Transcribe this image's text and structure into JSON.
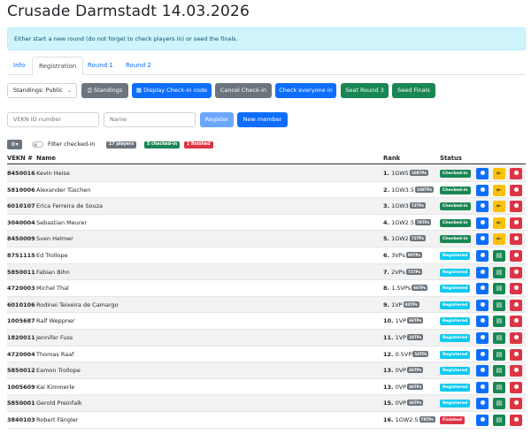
{
  "page": {
    "title": "Crusade Darmstadt 14.03.2026",
    "alert": "Either start a new round (do not forget to check players in) or seed the finals."
  },
  "tabs": [
    {
      "label": "Info",
      "active": false
    },
    {
      "label": "Registration",
      "active": true
    },
    {
      "label": "Round 1",
      "active": false
    },
    {
      "label": "Round 2",
      "active": false
    }
  ],
  "toolbar": {
    "standings_select": "Standings: Public",
    "standings_button": "Standings",
    "display_checkin": "Display Check-in code",
    "cancel_checkin": "Cancel Check-in",
    "check_everyone": "Check everyone in",
    "seat_round": "Seat Round 3",
    "seed_finals": "Seed Finals"
  },
  "registration_form": {
    "vekn_placeholder": "VEKN ID number",
    "name_placeholder": "Name",
    "register_button": "Register",
    "new_member_button": "New member"
  },
  "filter": {
    "label": "Filter checked-in",
    "players": "17 players",
    "checked_in": "5 checked-in",
    "finished": "1 finished"
  },
  "table": {
    "headers": {
      "vekn": "VEKN #",
      "name": "Name",
      "rank": "Rank",
      "status": "Status"
    },
    "rows": [
      {
        "vekn": "8450016",
        "name": "Kevin Heise",
        "rank": "1.",
        "score": "1GW5",
        "tps": "108TPs",
        "status": "Checked-in"
      },
      {
        "vekn": "5810006",
        "name": "Alexander Tüschen",
        "rank": "2.",
        "score": "1GW3.5",
        "tps": "108TPs",
        "status": "Checked-in"
      },
      {
        "vekn": "6010107",
        "name": "Erica Ferreira de Souza",
        "rank": "3.",
        "score": "1GW3",
        "tps": "72TPs",
        "status": "Checked-in"
      },
      {
        "vekn": "3040004",
        "name": "Sebastian Meurer",
        "rank": "4.",
        "score": "1GW2.5",
        "tps": "78TPs",
        "status": "Checked-in"
      },
      {
        "vekn": "8450009",
        "name": "Sven Helmer",
        "rank": "5.",
        "score": "1GW2",
        "tps": "72TPs",
        "status": "Checked-in"
      },
      {
        "vekn": "8751115",
        "name": "Ed Trollope",
        "rank": "6.",
        "score": "3VPs",
        "tps": "90TPs",
        "status": "Registered"
      },
      {
        "vekn": "5850011",
        "name": "Fabian Bihn",
        "rank": "7.",
        "score": "2VPs",
        "tps": "72TPs",
        "status": "Registered"
      },
      {
        "vekn": "4720003",
        "name": "Michel Thal",
        "rank": "8.",
        "score": "1.5VPs",
        "tps": "66TPs",
        "status": "Registered"
      },
      {
        "vekn": "6010106",
        "name": "Rodinei Teixeira de Camargo",
        "rank": "9.",
        "score": "1VP",
        "tps": "84TPs",
        "status": "Registered"
      },
      {
        "vekn": "1005687",
        "name": "Ralf Weppner",
        "rank": "10.",
        "score": "1VP",
        "tps": "66TPs",
        "status": "Registered"
      },
      {
        "vekn": "1820011",
        "name": "Jennifer Fuss",
        "rank": "11.",
        "score": "1VP",
        "tps": "34TPs",
        "status": "Registered"
      },
      {
        "vekn": "4720004",
        "name": "Thomas Raaf",
        "rank": "12.",
        "score": "0.5VP",
        "tps": "54TPs",
        "status": "Registered"
      },
      {
        "vekn": "5850012",
        "name": "Eamon Trollope",
        "rank": "13.",
        "score": "0VP",
        "tps": "46TPs",
        "status": "Registered"
      },
      {
        "vekn": "1005609",
        "name": "Kai Kimmerle",
        "rank": "13.",
        "score": "0VP",
        "tps": "46TPs",
        "status": "Registered"
      },
      {
        "vekn": "5850001",
        "name": "Gerold Preinfalk",
        "rank": "15.",
        "score": "0VP",
        "tps": "36TPs",
        "status": "Registered"
      },
      {
        "vekn": "3840103",
        "name": "Robert Fängler",
        "rank": "16.",
        "score": "1GW2.5",
        "tps": "78TPs",
        "status": "Finished"
      }
    ]
  },
  "colors": {
    "primary": "#0d6efd",
    "success": "#198754",
    "info": "#0dcaf0",
    "danger": "#dc3545",
    "warning": "#ffc107",
    "secondary": "#6c757d"
  }
}
